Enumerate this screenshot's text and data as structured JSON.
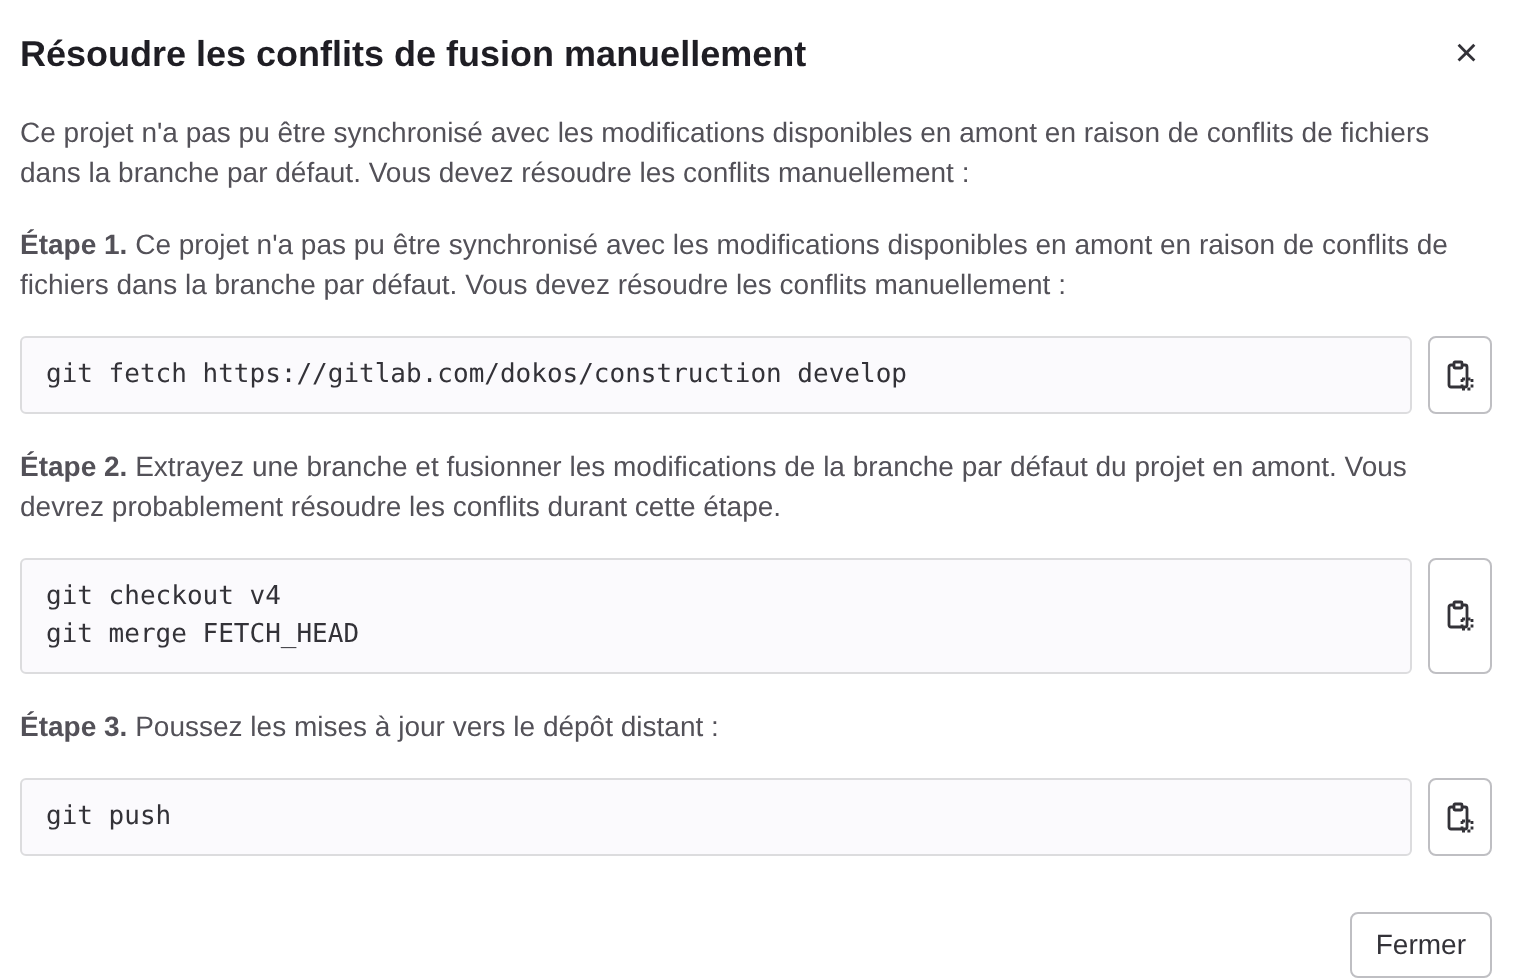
{
  "dialog": {
    "title": "Résoudre les conflits de fusion manuellement",
    "close_label": "×",
    "intro": "Ce projet n'a pas pu être synchronisé avec les modifications disponibles en amont en raison de conflits de fichiers dans la branche par défaut. Vous devez résoudre les conflits manuellement :",
    "steps": [
      {
        "text": "**Étape 1.** Ce projet n'a pas pu être synchronisé avec les modifications disponibles en amont en raison de conflits de fichiers dans la branche par défaut. Vous devez résoudre les conflits manuellement :",
        "commands": [
          "git fetch https://gitlab.com/dokos/construction develop"
        ]
      },
      {
        "text": "**Étape 2.** Extrayez une branche et fusionner les modifications de la branche par défaut du projet en amont. Vous devrez probablement résoudre les conflits durant cette étape.",
        "commands": [
          "git checkout v4",
          "git merge FETCH_HEAD"
        ]
      },
      {
        "text": "**Étape 3.** Poussez les mises à jour vers le dépôt distant :",
        "commands": [
          "git push"
        ]
      }
    ],
    "buttons": [
      "Fermer"
    ]
  }
}
